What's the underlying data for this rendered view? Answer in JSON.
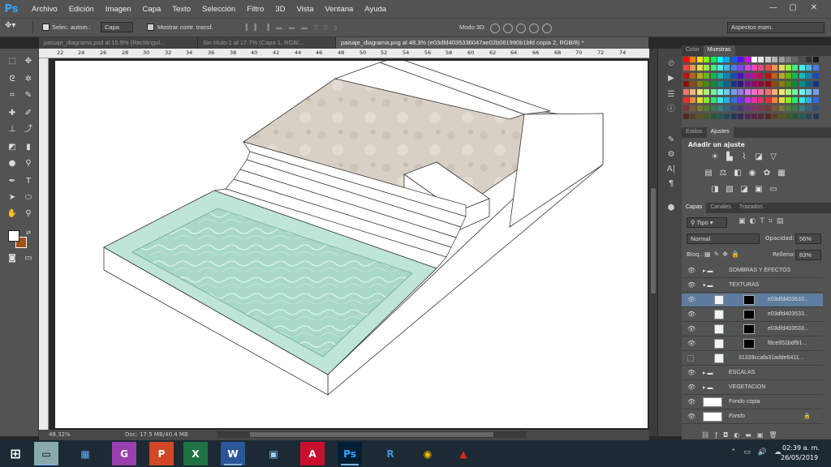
{
  "app": {
    "logo": "Ps",
    "menu": [
      "Archivo",
      "Edición",
      "Imagen",
      "Capa",
      "Texto",
      "Selección",
      "Filtro",
      "3D",
      "Vista",
      "Ventana",
      "Ayuda"
    ],
    "window_controls": [
      "—",
      "▢",
      "✕"
    ]
  },
  "options": {
    "auto_select_label": "Selec. autom.:",
    "auto_select_value": "Capa",
    "transform_label": "Mostrar contr. transf.",
    "mode3d_label": "Modo 3D:",
    "workspace": "Aspectos esen."
  },
  "tabs": [
    {
      "label": "paisaje_diagrama.psd al 15.9% (Rectángul...",
      "close": "×"
    },
    {
      "label": "Sin título-1 al 17.7% (Capa 1, RGB/...",
      "close": "×"
    },
    {
      "label": "paisaje_diagrama.png al 48.3% (e03dfd4035336047ae02b061990b1bfd copia 2, RGB/8) *",
      "close": "×"
    }
  ],
  "ruler_top": [
    "22",
    "24",
    "26",
    "28",
    "30",
    "32",
    "34",
    "36",
    "38",
    "40",
    "42",
    "44",
    "46",
    "48",
    "50",
    "52",
    "54",
    "56",
    "58",
    "60",
    "62",
    "64",
    "66",
    "68",
    "70",
    "72",
    "74"
  ],
  "status": {
    "zoom": "48.32%",
    "doc": "Doc: 17.5 MB/40.4 MB"
  },
  "panel_color": {
    "tabs": [
      "Color",
      "Muestras"
    ]
  },
  "panel_adjust": {
    "tabs": [
      "Estilos",
      "Ajustes"
    ],
    "title": "Añadir un ajuste"
  },
  "panel_layers": {
    "tabs": [
      "Capas",
      "Canales",
      "Trazados"
    ],
    "filter": "Tipo",
    "blend": "Normal",
    "opacity_label": "Opacidad:",
    "opacity": "56%",
    "lock_label": "Bloq.:",
    "fill_label": "Relleno:",
    "fill": "83%",
    "layers": [
      {
        "name": "SOMBRAS Y EFECTOS",
        "type": "group"
      },
      {
        "name": "TEXTURAS",
        "type": "group"
      },
      {
        "name": "e03dfd403533...",
        "type": "masked",
        "selected": true
      },
      {
        "name": "e03dfd403533...",
        "type": "masked"
      },
      {
        "name": "e03dfd403533...",
        "type": "masked"
      },
      {
        "name": "f8ce651bdf91...",
        "type": "masked"
      },
      {
        "name": "31339ccafa31adde6411...",
        "type": "plain",
        "hidden": true
      },
      {
        "name": "ESCALAS",
        "type": "group"
      },
      {
        "name": "VEGETACION",
        "type": "group"
      },
      {
        "name": "Fondo copia",
        "type": "plain"
      },
      {
        "name": "Fondo",
        "type": "locked",
        "lock": "🔒"
      }
    ]
  },
  "taskbar": {
    "apps": [
      "⊞",
      "▦",
      "G",
      "P",
      "X",
      "W",
      "▣",
      "A",
      "Ps",
      "R",
      "◉",
      "▲"
    ],
    "time": "02:39 a. m.",
    "date": "26/05/2019"
  },
  "colors": {
    "accent": "#31a8ff",
    "pool": "#a8d8c8",
    "ground": "#d8cfc5",
    "bg_color": "#a0521c"
  }
}
